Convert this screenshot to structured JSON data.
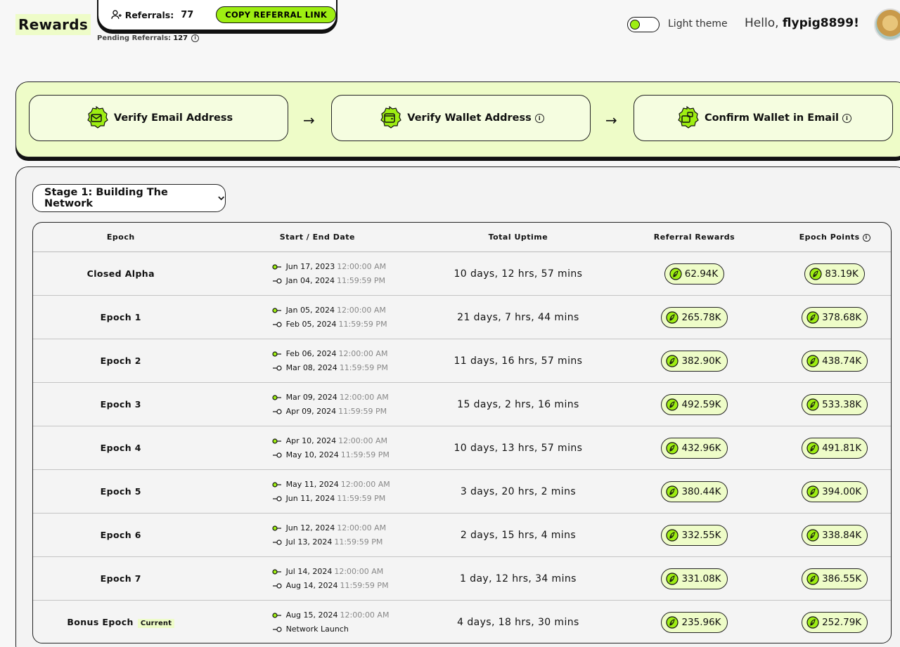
{
  "header": {
    "title": "Rewards",
    "referrals_label": "Referrals:",
    "referrals_count": "77",
    "copy_button": "COPY REFERRAL LINK",
    "pending_label": "Pending Referrals:",
    "pending_count": "127",
    "theme_label": "Light theme",
    "greeting": "Hello,",
    "username": "flypig8899!"
  },
  "steps": [
    {
      "label": "Verify Email Address",
      "icon": "email-icon"
    },
    {
      "label": "Verify Wallet Address",
      "icon": "wallet-icon"
    },
    {
      "label": "Confirm Wallet in Email",
      "icon": "wallet-confirm-icon"
    }
  ],
  "stage_select": "Stage 1: Building The Network",
  "table": {
    "headers": {
      "epoch": "Epoch",
      "date": "Start / End Date",
      "uptime": "Total Uptime",
      "referral": "Referral Rewards",
      "points": "Epoch Points"
    },
    "rows": [
      {
        "epoch": "Closed Alpha",
        "start": "Jun 17, 2023",
        "start_time": "12:00:00 AM",
        "end": "Jan 04, 2024",
        "end_time": "11:59:59 PM",
        "uptime": "10 days, 12 hrs, 57 mins",
        "referral": "62.94K",
        "points": "83.19K"
      },
      {
        "epoch": "Epoch 1",
        "start": "Jan 05, 2024",
        "start_time": "12:00:00 AM",
        "end": "Feb 05, 2024",
        "end_time": "11:59:59 PM",
        "uptime": "21 days, 7 hrs, 44 mins",
        "referral": "265.78K",
        "points": "378.68K"
      },
      {
        "epoch": "Epoch 2",
        "start": "Feb 06, 2024",
        "start_time": "12:00:00 AM",
        "end": "Mar 08, 2024",
        "end_time": "11:59:59 PM",
        "uptime": "11 days, 16 hrs, 57 mins",
        "referral": "382.90K",
        "points": "438.74K"
      },
      {
        "epoch": "Epoch 3",
        "start": "Mar 09, 2024",
        "start_time": "12:00:00 AM",
        "end": "Apr 09, 2024",
        "end_time": "11:59:59 PM",
        "uptime": "15 days, 2 hrs, 16 mins",
        "referral": "492.59K",
        "points": "533.38K"
      },
      {
        "epoch": "Epoch 4",
        "start": "Apr 10, 2024",
        "start_time": "12:00:00 AM",
        "end": "May 10, 2024",
        "end_time": "11:59:59 PM",
        "uptime": "10 days, 13 hrs, 57 mins",
        "referral": "432.96K",
        "points": "491.81K"
      },
      {
        "epoch": "Epoch 5",
        "start": "May 11, 2024",
        "start_time": "12:00:00 AM",
        "end": "Jun 11, 2024",
        "end_time": "11:59:59 PM",
        "uptime": "3 days, 20 hrs, 2 mins",
        "referral": "380.44K",
        "points": "394.00K"
      },
      {
        "epoch": "Epoch 6",
        "start": "Jun 12, 2024",
        "start_time": "12:00:00 AM",
        "end": "Jul 13, 2024",
        "end_time": "11:59:59 PM",
        "uptime": "2 days, 15 hrs, 4 mins",
        "referral": "332.55K",
        "points": "338.84K"
      },
      {
        "epoch": "Epoch 7",
        "start": "Jul 14, 2024",
        "start_time": "12:00:00 AM",
        "end": "Aug 14, 2024",
        "end_time": "11:59:59 PM",
        "uptime": "1 day, 12 hrs, 34 mins",
        "referral": "331.08K",
        "points": "386.55K"
      },
      {
        "epoch": "Bonus Epoch",
        "tag": "Current",
        "start": "Aug 15, 2024",
        "start_time": "12:00:00 AM",
        "end": "Network Launch",
        "end_time": "",
        "uptime": "4 days, 18 hrs, 30 mins",
        "referral": "235.96K",
        "points": "252.79K"
      }
    ]
  },
  "colors": {
    "accent": "#9eee12",
    "accent_light": "#eefcc8",
    "ink": "#111111"
  }
}
